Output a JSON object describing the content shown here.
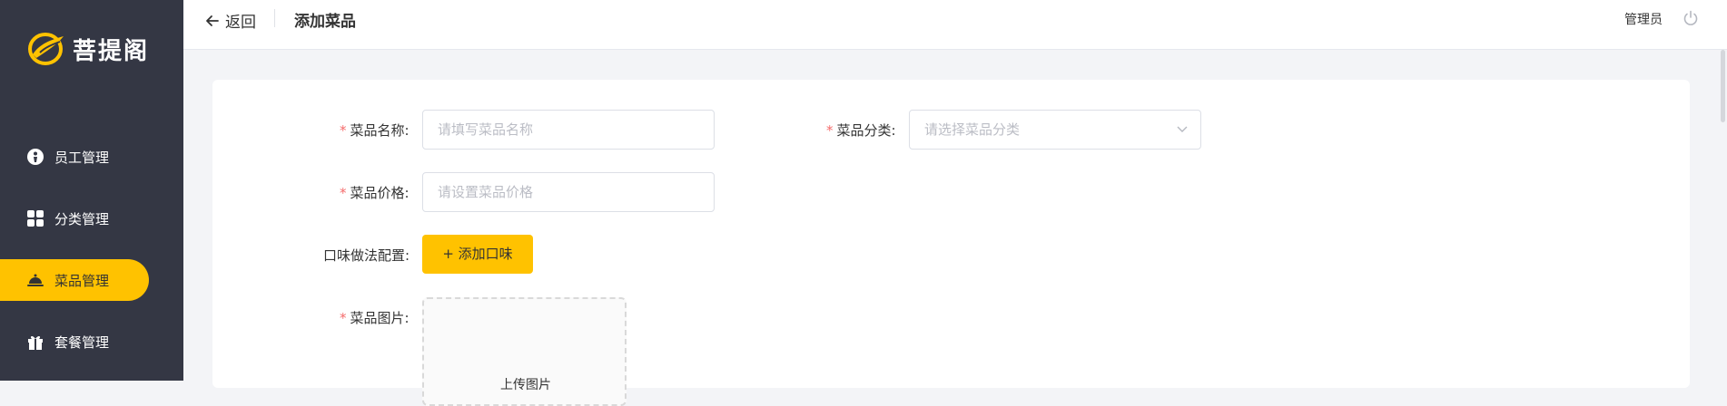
{
  "brand": {
    "name": "菩提阁",
    "accent": "#ffc200",
    "sidebar_bg": "#343744"
  },
  "sidebar": {
    "items": [
      {
        "label": "员工管理",
        "icon": "employee-icon",
        "active": false
      },
      {
        "label": "分类管理",
        "icon": "category-icon",
        "active": false
      },
      {
        "label": "菜品管理",
        "icon": "dish-cloche-icon",
        "active": true
      },
      {
        "label": "套餐管理",
        "icon": "gift-icon",
        "active": false
      }
    ]
  },
  "header": {
    "back_label": "返回",
    "title": "添加菜品",
    "user_label": "管理员",
    "logout_icon": "power-icon"
  },
  "form": {
    "name": {
      "label": "菜品名称:",
      "placeholder": "请填写菜品名称",
      "required": true
    },
    "category": {
      "label": "菜品分类:",
      "placeholder": "请选择菜品分类",
      "required": true
    },
    "price": {
      "label": "菜品价格:",
      "placeholder": "请设置菜品价格",
      "required": true
    },
    "flavor": {
      "label": "口味做法配置:",
      "button_label": "+ 添加口味"
    },
    "image": {
      "label": "菜品图片:",
      "upload_text": "上传图片",
      "required": true
    }
  },
  "required_mark": "*"
}
